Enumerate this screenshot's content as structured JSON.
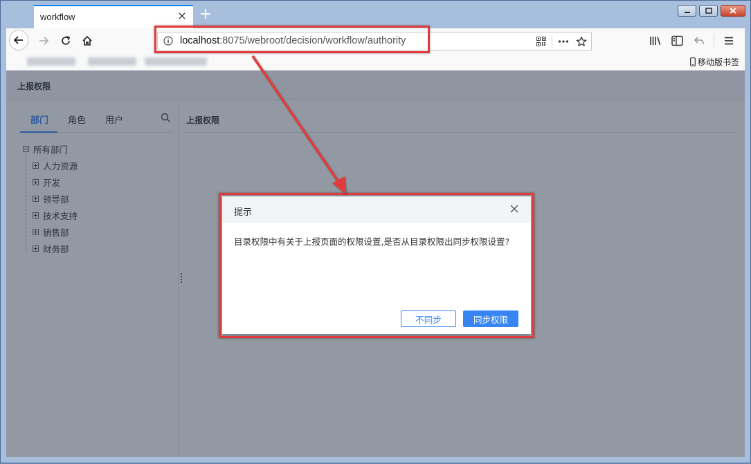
{
  "browser": {
    "tab_title": "workflow",
    "url_host": "localhost",
    "url_rest": ":8075/webroot/decision/workflow/authority",
    "mobile_bookmarks_label": "移动版书签"
  },
  "page": {
    "header_title": "上报权限",
    "tabs": [
      "部门",
      "角色",
      "用户"
    ],
    "tree": {
      "root": "所有部门",
      "children": [
        "人力资源",
        "开发",
        "领导部",
        "技术支持",
        "销售部",
        "财务部"
      ]
    },
    "right_title": "上报权限"
  },
  "dialog": {
    "title": "提示",
    "message": "目录权限中有关于上报页面的权限设置,是否从目录权限出同步权限设置?",
    "btn_nosync": "不同步",
    "btn_sync": "同步权限"
  },
  "colors": {
    "accent": "#3685f2",
    "annotation": "#e23a3a"
  }
}
